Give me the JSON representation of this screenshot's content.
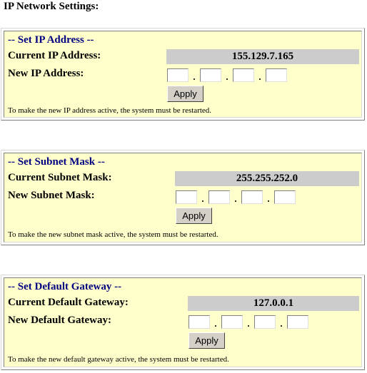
{
  "page_title": "IP Network Settings:",
  "sections": [
    {
      "title": "-- Set IP Address --",
      "current_label": "Current IP Address:",
      "current_value": "155.129.7.165",
      "new_label": "New IP Address:",
      "octets": [
        "",
        "",
        "",
        ""
      ],
      "separator": ".",
      "apply_label": "Apply",
      "note": "To make the new IP address active, the system must be restarted."
    },
    {
      "title": "-- Set Subnet Mask --",
      "current_label": "Current Subnet Mask:",
      "current_value": "255.255.252.0",
      "new_label": "New Subnet Mask:",
      "octets": [
        "",
        "",
        "",
        ""
      ],
      "separator": ".",
      "apply_label": "Apply",
      "note": "To make the new subnet mask active, the system must be restarted."
    },
    {
      "title": "-- Set Default Gateway --",
      "current_label": "Current Default Gateway:",
      "current_value": "127.0.0.1",
      "new_label": "New Default Gateway:",
      "octets": [
        "",
        "",
        "",
        ""
      ],
      "separator": ".",
      "apply_label": "Apply",
      "note": "To make the new default gateway active, the system must be restarted."
    }
  ],
  "colors": {
    "panel_bg": "#ffffcc",
    "section_title": "#000080",
    "current_value_bg": "#cccccc",
    "button_bg": "#d4d0c8"
  }
}
